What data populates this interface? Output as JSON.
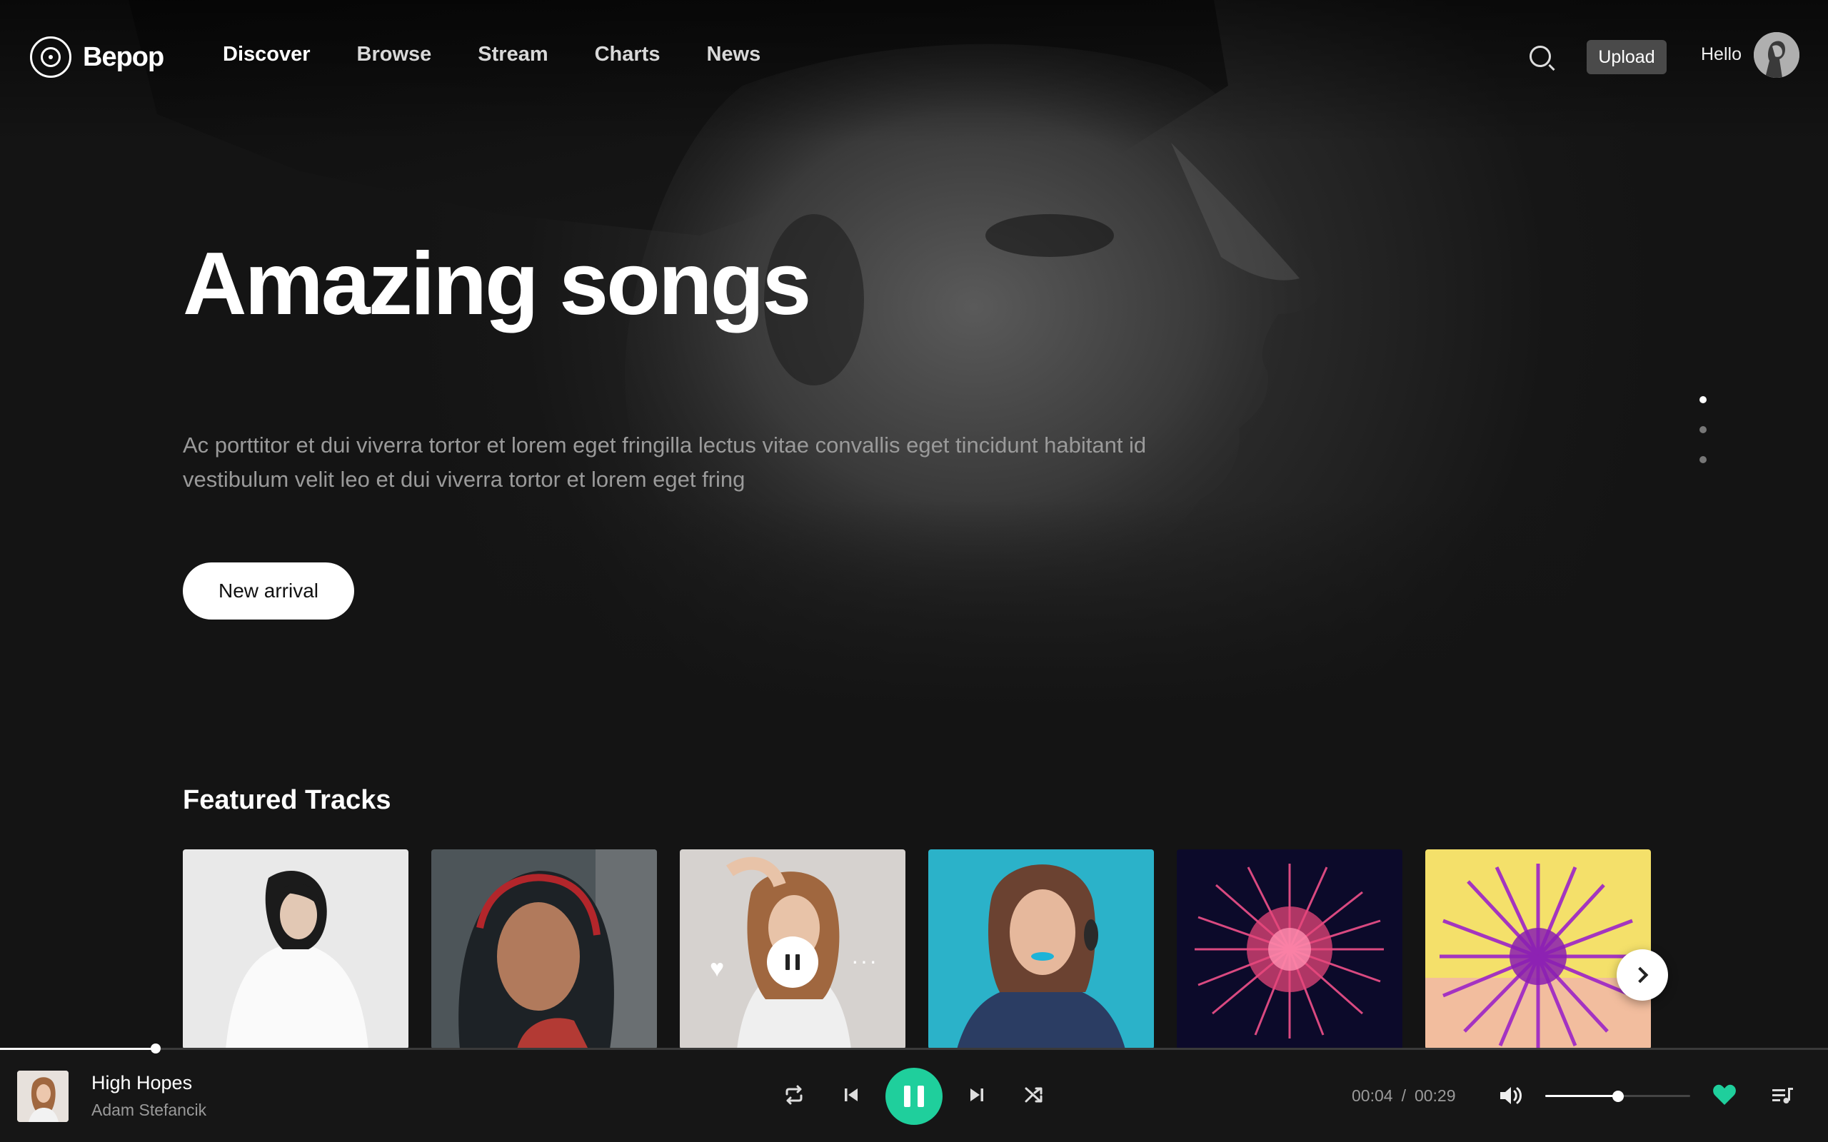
{
  "brand": {
    "name": "Bepop",
    "icon": "vinyl-logo-icon"
  },
  "nav": {
    "items": [
      {
        "label": "Discover",
        "active": true
      },
      {
        "label": "Browse",
        "active": false
      },
      {
        "label": "Stream",
        "active": false
      },
      {
        "label": "Charts",
        "active": false
      },
      {
        "label": "News",
        "active": false
      }
    ]
  },
  "header": {
    "search_icon": "search-icon",
    "upload_label": "Upload",
    "greeting": "Hello"
  },
  "hero": {
    "title": "Amazing songs",
    "description": "Ac porttitor et dui viverra tortor et lorem eget fringilla lectus vitae convallis eget tincidunt habitant id vestibulum velit leo et dui viverra tortor et lorem eget fring",
    "cta_label": "New arrival",
    "slides": {
      "count": 3,
      "active_index": 0
    }
  },
  "featured": {
    "title": "Featured Tracks",
    "tracks": [
      {
        "art": "woman-white-shirt"
      },
      {
        "art": "woman-hijab"
      },
      {
        "art": "woman-curly-hair",
        "playing": true
      },
      {
        "art": "woman-blue-lips"
      },
      {
        "art": "pink-burst-dark"
      },
      {
        "art": "purple-burst-yellow"
      }
    ],
    "next_icon": "chevron-right-icon"
  },
  "player": {
    "title": "High Hopes",
    "artist": "Adam Stefancik",
    "current_time": "00:04",
    "time_separator": "/",
    "duration": "00:29",
    "progress_fraction": 0.085,
    "volume_fraction": 0.5,
    "colors": {
      "accent": "#1fcf9c"
    },
    "icons": [
      "repeat-icon",
      "previous-icon",
      "pause-icon",
      "next-icon",
      "shuffle-icon",
      "volume-icon",
      "heart-icon",
      "playlist-icon"
    ]
  }
}
